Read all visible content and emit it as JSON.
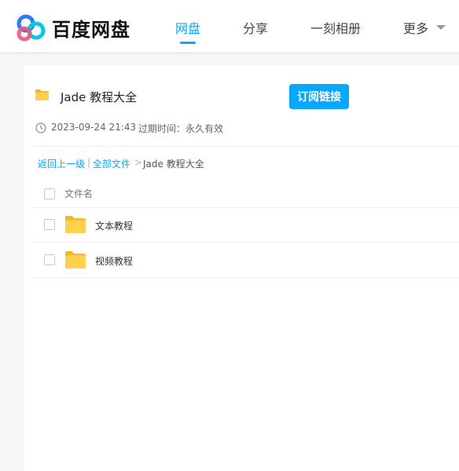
{
  "header": {
    "brand": "百度网盘",
    "nav": [
      {
        "label": "网盘",
        "active": true
      },
      {
        "label": "分享",
        "active": false
      },
      {
        "label": "一刻相册",
        "active": false
      },
      {
        "label": "更多",
        "active": false
      }
    ]
  },
  "share": {
    "title": "Jade 教程大全",
    "subscribe_label": "订阅链接",
    "date": "2023-09-24 21:43",
    "expire_label": "过期时间：永久有效"
  },
  "breadcrumb": {
    "back": "返回上一级",
    "separator": "|",
    "all_files": "全部文件",
    "arrow": ">",
    "current": "Jade 教程大全"
  },
  "file_list": {
    "column_name": "文件名",
    "items": [
      {
        "name": "文本教程",
        "icon": "folder-icon"
      },
      {
        "name": "视频教程",
        "icon": "folder-icon"
      }
    ]
  },
  "colors": {
    "accent": "#06a7ff",
    "folder": "#ffd24d",
    "background": "#f5f6f7"
  }
}
